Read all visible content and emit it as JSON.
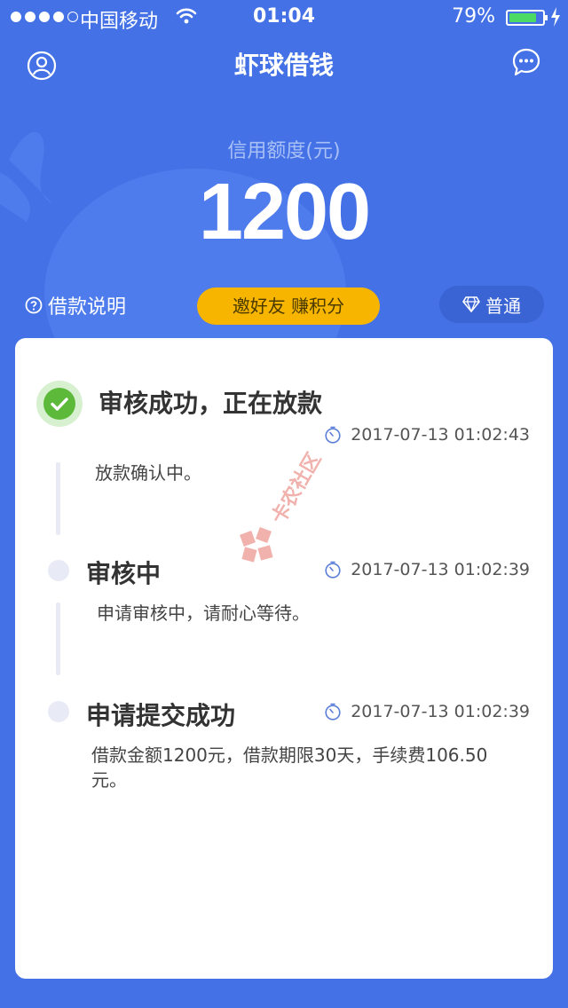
{
  "status_bar": {
    "carrier": "中国移动",
    "time": "01:04",
    "battery": "79%"
  },
  "nav": {
    "title": "虾球借钱",
    "left_icon": "user-icon",
    "right_icon": "message-icon"
  },
  "credit": {
    "label": "信用额度(元)",
    "value": "1200"
  },
  "actions": {
    "loan_help": "借款说明",
    "invite": "邀好友 赚积分",
    "level": "普通"
  },
  "steps": [
    {
      "title": "审核成功，正在放款",
      "time": "2017-07-13 01:02:43",
      "desc": "放款确认中。",
      "status": "done"
    },
    {
      "title": "审核中",
      "time": "2017-07-13 01:02:39",
      "desc": "申请审核中，请耐心等待。",
      "status": "pending"
    },
    {
      "title": "申请提交成功",
      "time": "2017-07-13 01:02:39",
      "desc": "借款金额1200元，借款期限30天，手续费106.50元。",
      "status": "pending"
    }
  ],
  "watermark": "卡农社区",
  "colors": {
    "background": "#4472e6",
    "accent_yellow": "#f7b500",
    "success_green": "#5cb93a"
  }
}
